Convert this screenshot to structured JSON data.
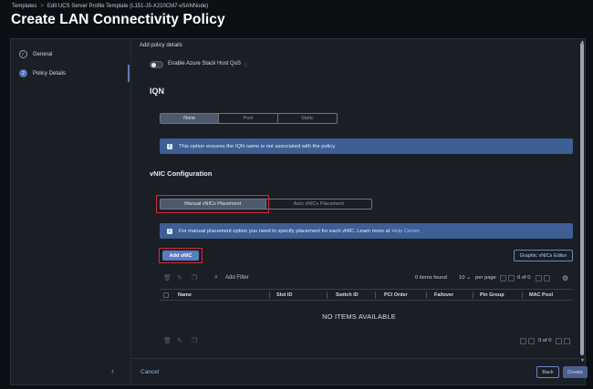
{
  "breadcrumb": {
    "root": "Templates",
    "sep": ">",
    "current": "Edit UCS Server Profile Template (L151-J5-X210CM7-vSANNode)"
  },
  "page": {
    "title": "Create LAN Connectivity Policy"
  },
  "steps": [
    {
      "num": "✓",
      "label": "General",
      "state": "done"
    },
    {
      "num": "2",
      "label": "Policy Details",
      "state": "active"
    }
  ],
  "content": {
    "subtitle": "Add policy details",
    "azure_toggle": {
      "label": "Enable Azure Stack Host QoS",
      "on": false
    },
    "iqn": {
      "heading": "IQN",
      "options": [
        "None",
        "Pool",
        "Static"
      ],
      "selected": "None",
      "banner": "This option ensures the IQN name is not associated with the policy"
    },
    "vnic": {
      "heading": "vNIC Configuration",
      "options": [
        "Manual vNICs Placement",
        "Auto vNICs Placement"
      ],
      "selected": "Manual vNICs Placement",
      "banner_text": "For manual placement option you need to specify placement for each vNIC. Learn more at",
      "banner_link": "Help Center",
      "add_button": "Add vNIC",
      "graphic_button": "Graphic vNICs Editor"
    },
    "table": {
      "filter_placeholder": "Add Filter",
      "items_found": "0 items found",
      "per_page_value": "10",
      "per_page_chevron": "⌄",
      "per_page_label": "per page",
      "page_of": "0 of 0",
      "columns": [
        "Name",
        "Slot ID",
        "Switch ID",
        "PCI Order",
        "Failover",
        "Pin Group",
        "MAC Pool"
      ],
      "empty_message": "NO ITEMS AVAILABLE",
      "footer_page_of": "0 of 0"
    },
    "footer": {
      "cancel": "Cancel",
      "back": "Back",
      "create": "Create"
    }
  },
  "colors": {
    "accent": "#5b7bc2",
    "banner": "#3d5f93",
    "highlight": "#d62b34"
  }
}
